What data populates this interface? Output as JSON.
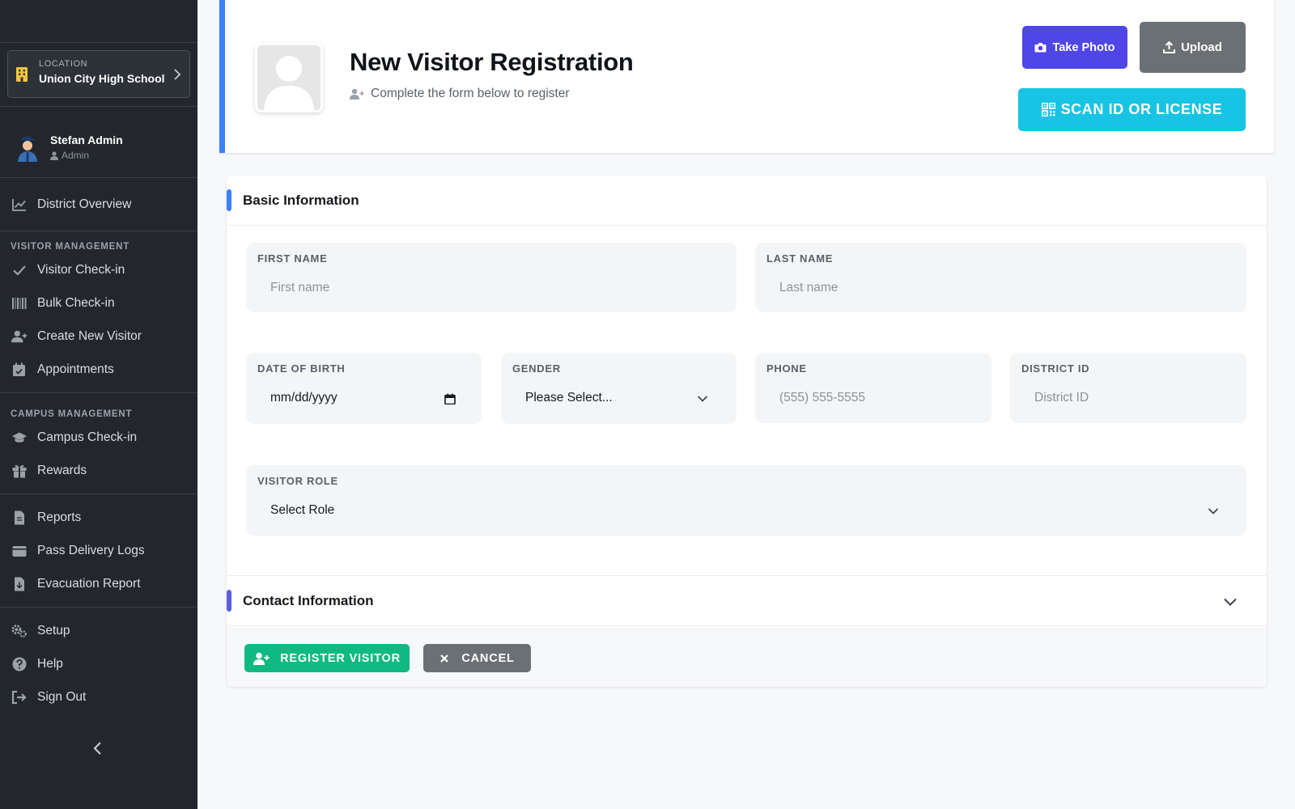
{
  "sidebar": {
    "location_caption": "LOCATION",
    "location_name": "Union City High School",
    "user_name": "Stefan Admin",
    "user_role": "Admin",
    "overview": "District Overview",
    "visitor_section": "VISITOR MANAGEMENT",
    "visitor_items": [
      "Visitor Check-in",
      "Bulk Check-in",
      "Create New Visitor",
      "Appointments"
    ],
    "campus_section": "CAMPUS MANAGEMENT",
    "campus_items": [
      "Campus Check-in",
      "Rewards"
    ],
    "report_items": [
      "Reports",
      "Pass Delivery Logs",
      "Evacuation Report"
    ],
    "system_items": [
      "Setup",
      "Help",
      "Sign Out"
    ]
  },
  "header": {
    "title": "New Visitor Registration",
    "subtitle": "Complete the form below to register",
    "take_photo": "Take Photo",
    "upload": "Upload",
    "scan": "SCAN ID OR LICENSE"
  },
  "basic": {
    "title": "Basic Information",
    "first_name_label": "FIRST NAME",
    "first_name_placeholder": "First name",
    "last_name_label": "LAST NAME",
    "last_name_placeholder": "Last name",
    "dob_label": "DATE OF BIRTH",
    "dob_value": "mm/dd/yyyy",
    "gender_label": "GENDER",
    "gender_value": "Please Select...",
    "phone_label": "PHONE",
    "phone_placeholder": "(555) 555-5555",
    "district_label": "DISTRICT ID",
    "district_placeholder": "District ID",
    "role_label": "VISITOR ROLE",
    "role_value": "Select Role"
  },
  "contact": {
    "title": "Contact Information"
  },
  "actions": {
    "register": "REGISTER VISITOR",
    "cancel": "CANCEL"
  },
  "colors": {
    "sidebar_bg": "#23272d",
    "accent_blue": "#3b82f6",
    "photo_button": "#4f46e5",
    "scan_button": "#17c4e3",
    "register_button": "#10b981",
    "neutral_button": "#6b7075"
  },
  "icons": [
    "building-icon",
    "chevron-right-icon",
    "user-icon",
    "chart-line-icon",
    "check-icon",
    "barcode-icon",
    "user-plus-icon",
    "calendar-icon",
    "graduation-cap-icon",
    "gift-icon",
    "file-icon",
    "wallet-icon",
    "file-download-icon",
    "gears-icon",
    "question-icon",
    "sign-out-icon",
    "chevron-left-icon",
    "camera-icon",
    "upload-icon",
    "qrcode-icon",
    "calendar-small-icon",
    "chevron-down-icon",
    "times-icon"
  ]
}
